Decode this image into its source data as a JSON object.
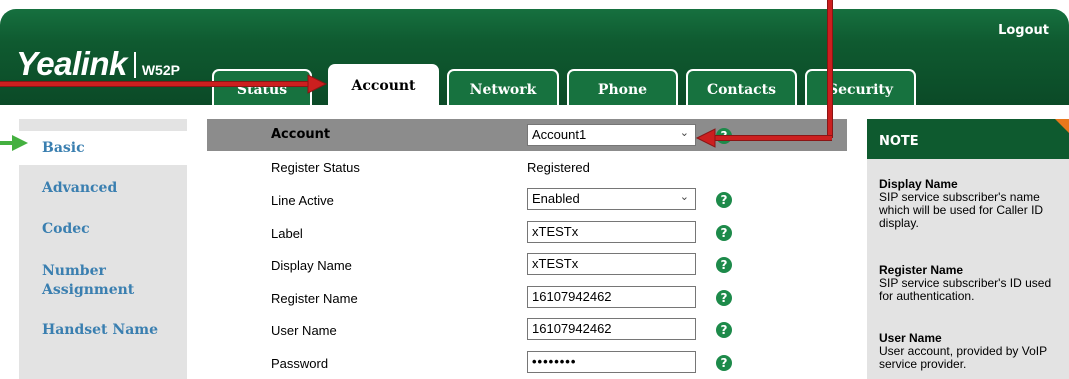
{
  "header": {
    "logo_word": "Yealink",
    "logo_model": "W52P",
    "logout_label": "Logout"
  },
  "tabs": [
    {
      "label": "Status",
      "active": false
    },
    {
      "label": "Account",
      "active": true
    },
    {
      "label": "Network",
      "active": false
    },
    {
      "label": "Phone",
      "active": false
    },
    {
      "label": "Contacts",
      "active": false
    },
    {
      "label": "Security",
      "active": false
    }
  ],
  "sidebar": {
    "items": [
      {
        "label": "Basic",
        "active": true
      },
      {
        "label": "Advanced",
        "active": false
      },
      {
        "label": "Codec",
        "active": false
      },
      {
        "label": "Number Assignment",
        "active": false
      },
      {
        "label": "Handset Name",
        "active": false
      }
    ]
  },
  "form": {
    "account_label": "Account",
    "account_value": "Account1",
    "register_status_label": "Register Status",
    "register_status_value": "Registered",
    "line_active_label": "Line Active",
    "line_active_value": "Enabled",
    "label_label": "Label",
    "label_value": "xTESTx",
    "display_name_label": "Display Name",
    "display_name_value": "xTESTx",
    "register_name_label": "Register Name",
    "register_name_value": "16107942462",
    "user_name_label": "User Name",
    "user_name_value": "16107942462",
    "password_label": "Password",
    "password_value": "••••••••",
    "help_glyph": "?"
  },
  "note": {
    "title": "NOTE",
    "entries": [
      {
        "title": "Display Name",
        "text": "SIP service subscriber's name which will be used for Caller ID display."
      },
      {
        "title": "Register Name",
        "text": "SIP service subscriber's ID used for authentication."
      },
      {
        "title": "User Name",
        "text": "User account, provided by VoIP service provider."
      }
    ]
  },
  "colors": {
    "header_green": "#0f5a30",
    "tab_green": "#17723f",
    "sidebar_link": "#3a7fb0",
    "help_green": "#1d8a4a",
    "annotation_red": "#cc1f1f",
    "annotation_green": "#44b040",
    "note_corner": "#e8771c"
  },
  "icons": {
    "help": "question-circle-icon",
    "dropdown": "chevron-down-icon",
    "annotation": "arrow-icon"
  }
}
